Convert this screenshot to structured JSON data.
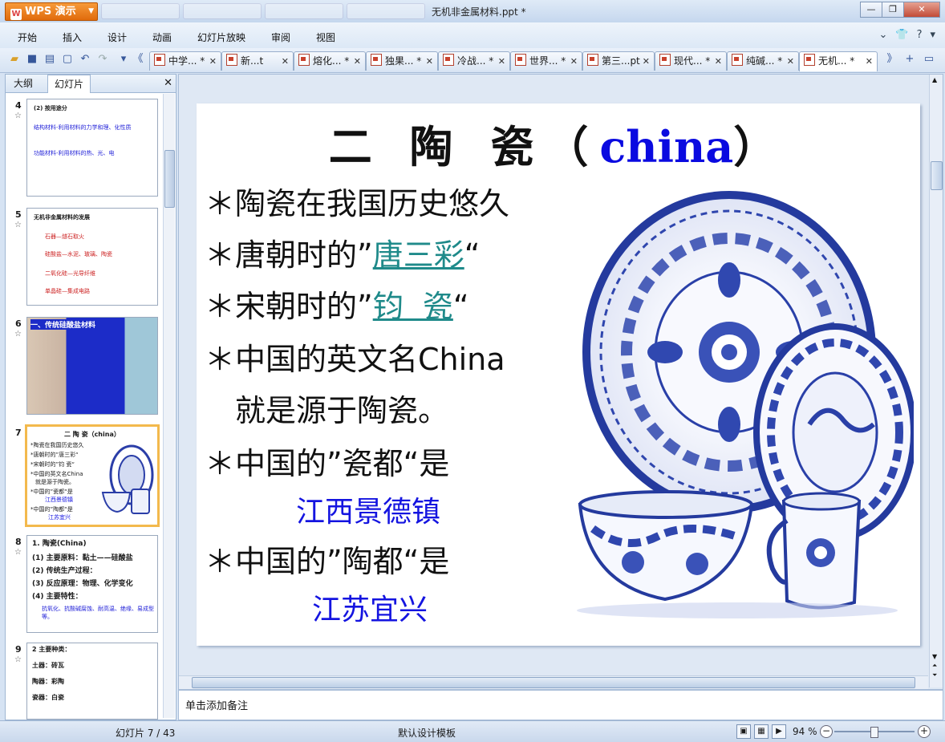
{
  "app": {
    "name": "WPS 演示",
    "doc_title": "无机非金属材料.ppt *"
  },
  "menu": [
    "开始",
    "插入",
    "设计",
    "动画",
    "幻灯片放映",
    "审阅",
    "视图"
  ],
  "doc_tabs": [
    {
      "label": "中学... *"
    },
    {
      "label": "新...t"
    },
    {
      "label": "熔化... *"
    },
    {
      "label": "独果... *"
    },
    {
      "label": "冷战... *"
    },
    {
      "label": "世界... *"
    },
    {
      "label": "第三...pt"
    },
    {
      "label": "现代... *"
    },
    {
      "label": "纯碱... *"
    },
    {
      "label": "无机... *"
    }
  ],
  "left_panel": {
    "tabs": [
      "大纲",
      "幻灯片"
    ],
    "slides": [
      {
        "num": "4",
        "lines": [
          "(2) 按用途分",
          "结构材料-利用材料的力学和理、化性质",
          "功能材料-利用材料的热、光、电"
        ]
      },
      {
        "num": "5",
        "lines": [
          "无机非金属材料的发展",
          "石器—燧石取火",
          "硅酸盐—水泥、玻璃、陶瓷",
          "二氧化硅—光导纤维",
          "单晶硅—集成电路"
        ]
      },
      {
        "num": "6",
        "lines": [
          "一、传统硅酸盐材料"
        ]
      },
      {
        "num": "7",
        "lines": [
          "二 陶 瓷（china）",
          "*陶瓷在我国历史悠久",
          "*唐朝时的”唐三彩“",
          "*宋朝时的”钧 瓷“",
          "*中国的英文名China",
          "就是源于陶瓷。",
          "*中国的”瓷都“是",
          "江西景德镇",
          "*中国的”陶都“是",
          "江苏宜兴"
        ]
      },
      {
        "num": "8",
        "lines": [
          "1. 陶瓷(China)",
          "(1) 主要原料：黏土——硅酸盐",
          "(2) 传统生产过程：",
          "(3) 反应原理：物理、化学变化",
          "(4) 主要特性：",
          "抗氧化、抗酸碱腐蚀、耐高温、绝缘、易成型等。"
        ]
      },
      {
        "num": "9",
        "lines": [
          "2 主要种类：",
          "土器：砖瓦",
          "陶器：彩陶",
          "瓷器：白瓷"
        ]
      }
    ]
  },
  "slide": {
    "title_cn": "二 陶 瓷（",
    "title_en": "china",
    "title_end": "）",
    "bullets": [
      {
        "star": "＊",
        "text": "陶瓷在我国历史悠久"
      },
      {
        "star": "＊",
        "pre": "唐朝时的”",
        "link": "唐三彩",
        "post": "“"
      },
      {
        "star": "＊",
        "pre": "宋朝时的”",
        "link": "钧  瓷",
        "post": "“"
      },
      {
        "star": "＊",
        "text": "中国的英文名China"
      },
      {
        "star": "",
        "text": "就是源于陶瓷。"
      },
      {
        "star": "＊",
        "text": "中国的”瓷都“是"
      },
      {
        "star": "＊",
        "text": "中国的”陶都“是"
      }
    ],
    "place1": "江西景德镇",
    "place2": "江苏宜兴",
    "image_desc_icon": "blue-and-white-porcelain-image"
  },
  "notes_placeholder": "单击添加备注",
  "status": {
    "slide_counter": "幻灯片 7 / 43",
    "template": "默认设计模板",
    "zoom": "94 %"
  },
  "colors": {
    "accent_blue": "#0a0ae0",
    "link_teal": "#1f8a8a",
    "selection": "#f3b94d"
  }
}
